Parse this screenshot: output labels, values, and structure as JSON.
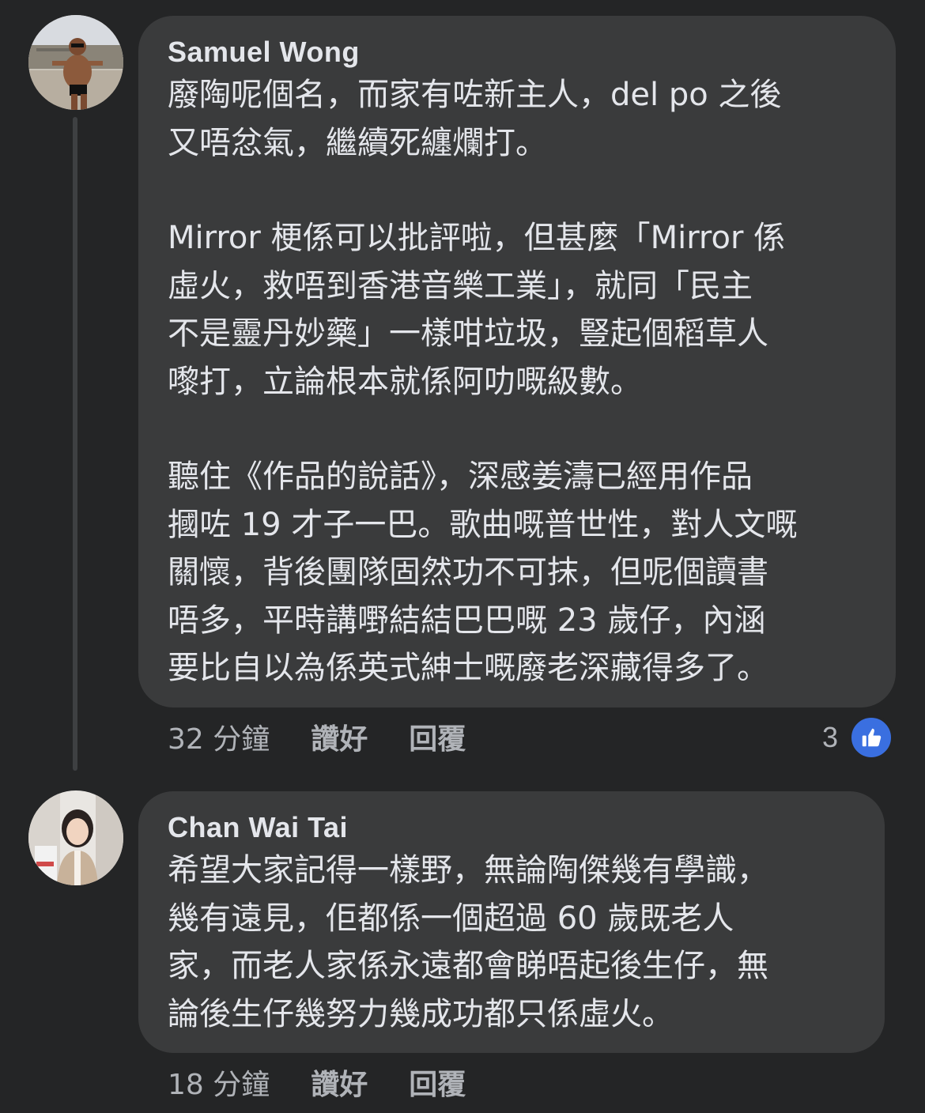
{
  "colors": {
    "background": "#242526",
    "bubble": "#3a3b3c",
    "text_primary": "#e4e6eb",
    "text_secondary": "#b0b3b8",
    "like_blue": "#3a6fe0"
  },
  "comments": [
    {
      "author": "Samuel Wong",
      "avatar_icon": "profile-photo-man-icon",
      "paragraphs": [
        [
          "廢陶呢個名，而家有咗新主人，del po 之後",
          "又唔忿氣，繼續死纏爛打。"
        ],
        [
          "Mirror 梗係可以批評啦，但甚麼「Mirror 係",
          "虛火，救唔到香港音樂工業」，就同「民主",
          "不是靈丹妙藥」一樣咁垃圾，豎起個稻草人",
          "嚟打，立論根本就係阿叻嘅級數。"
        ],
        [
          "聽住《作品的說話》，深感姜濤已經用作品",
          "摑咗 19 才子一巴。歌曲嘅普世性，對人文嘅",
          "關懷，背後團隊固然功不可抹，但呢個讀書",
          "唔多，平時講嘢結結巴巴嘅 23 歲仔，內涵",
          "要比自以為係英式紳士嘅廢老深藏得多了。"
        ]
      ],
      "time": "32 分鐘",
      "like_label": "讚好",
      "reply_label": "回覆",
      "reaction_count": "3",
      "reaction_icon": "thumbs-up-icon"
    },
    {
      "author": "Chan Wai Tai",
      "avatar_icon": "profile-photo-woman-icon",
      "paragraphs": [
        [
          "希望大家記得一樣野，無論陶傑幾有學識，",
          "幾有遠見，佢都係一個超過 60 歲既老人",
          "家，而老人家係永遠都會睇唔起後生仔，無",
          "論後生仔幾努力幾成功都只係虛火。"
        ]
      ],
      "time": "18 分鐘",
      "like_label": "讚好",
      "reply_label": "回覆"
    }
  ]
}
